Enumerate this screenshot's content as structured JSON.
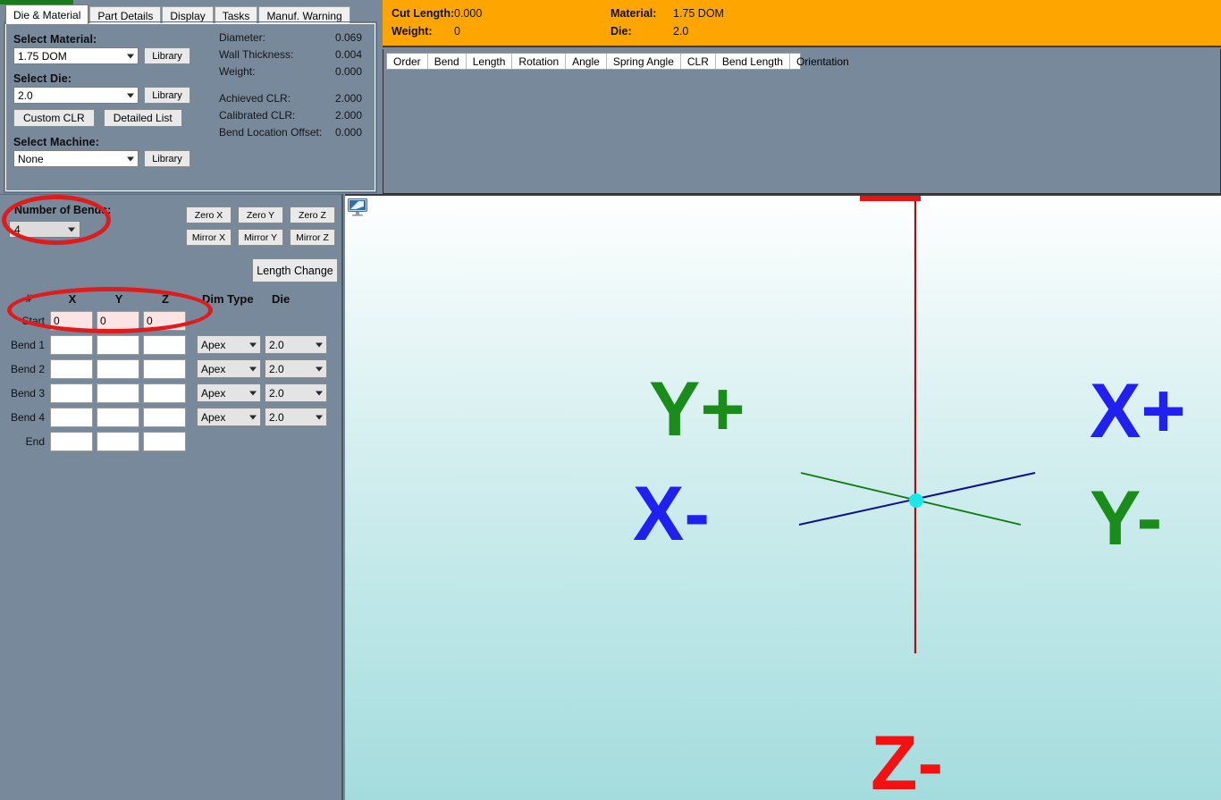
{
  "tabs": [
    {
      "label": "Die & Material",
      "active": true
    },
    {
      "label": "Part Details",
      "active": false
    },
    {
      "label": "Display",
      "active": false
    },
    {
      "label": "Tasks",
      "active": false
    },
    {
      "label": "Manuf. Warning",
      "active": false
    }
  ],
  "die_material": {
    "material_label": "Select Material:",
    "material_value": "1.75 DOM",
    "material_library_btn": "Library",
    "die_label": "Select Die:",
    "die_value": "2.0",
    "die_library_btn": "Library",
    "custom_clr_btn": "Custom CLR",
    "detailed_list_btn": "Detailed List",
    "machine_label": "Select Machine:",
    "machine_value": "None",
    "machine_library_btn": "Library",
    "info": [
      {
        "label": "Diameter:",
        "value": "0.069"
      },
      {
        "label": "Wall Thickness:",
        "value": "0.004"
      },
      {
        "label": "Weight:",
        "value": "0.000"
      },
      {
        "label": "Achieved CLR:",
        "value": "2.000"
      },
      {
        "label": "Calibrated CLR:",
        "value": "2.000"
      },
      {
        "label": "Bend Location Offset:",
        "value": "0.000"
      }
    ]
  },
  "summary_banner": {
    "cut_length_label": "Cut Length:",
    "cut_length_value": "0.000",
    "weight_label": "Weight:",
    "weight_value": "0",
    "material_label": "Material:",
    "material_value": "1.75 DOM",
    "die_label": "Die:",
    "die_value": "2.0",
    "background_color": "#ffa500"
  },
  "bend_grid": {
    "columns": [
      "Order",
      "Bend",
      "Length",
      "Rotation",
      "Angle",
      "Spring Angle",
      "CLR",
      "Bend Length",
      "Orientation"
    ],
    "rows": []
  },
  "bend_entry": {
    "number_of_bends_label": "Number of Bends:",
    "number_of_bends_value": "4",
    "zero_buttons": [
      "Zero X",
      "Zero Y",
      "Zero Z"
    ],
    "mirror_buttons": [
      "Mirror X",
      "Mirror Y",
      "Mirror Z"
    ],
    "length_change_btn": "Length Change",
    "headers": {
      "row": "#",
      "x": "X",
      "y": "Y",
      "z": "Z",
      "dim_type": "Dim Type",
      "die": "Die"
    },
    "rows": [
      {
        "label": "Start",
        "x": "0",
        "y": "0",
        "z": "0",
        "highlight": true,
        "dim_type": "",
        "die": ""
      },
      {
        "label": "Bend 1",
        "x": "",
        "y": "",
        "z": "",
        "highlight": false,
        "dim_type": "Apex",
        "die": "2.0"
      },
      {
        "label": "Bend 2",
        "x": "",
        "y": "",
        "z": "",
        "highlight": false,
        "dim_type": "Apex",
        "die": "2.0"
      },
      {
        "label": "Bend 3",
        "x": "",
        "y": "",
        "z": "",
        "highlight": false,
        "dim_type": "Apex",
        "die": "2.0"
      },
      {
        "label": "Bend 4",
        "x": "",
        "y": "",
        "z": "",
        "highlight": false,
        "dim_type": "Apex",
        "die": "2.0"
      },
      {
        "label": "End",
        "x": "",
        "y": "",
        "z": "",
        "highlight": false,
        "dim_type": "",
        "die": ""
      }
    ]
  },
  "viewport": {
    "axis_labels": {
      "y_plus": "Y+",
      "x_minus": "X-",
      "x_plus": "X+",
      "y_minus": "Y-",
      "z_minus": "Z-"
    },
    "colors": {
      "x_axis": "#00008b",
      "y_axis": "#1a8c1a",
      "z_axis": "#c01010",
      "origin_point": "#18e8e8",
      "x_label": "#2020f0",
      "y_label": "#1a8c1a",
      "z_label": "#f51111"
    }
  },
  "annotations": {
    "color": "#e01b1b",
    "ellipses": [
      "number-of-bends",
      "start-xyz-row"
    ]
  }
}
